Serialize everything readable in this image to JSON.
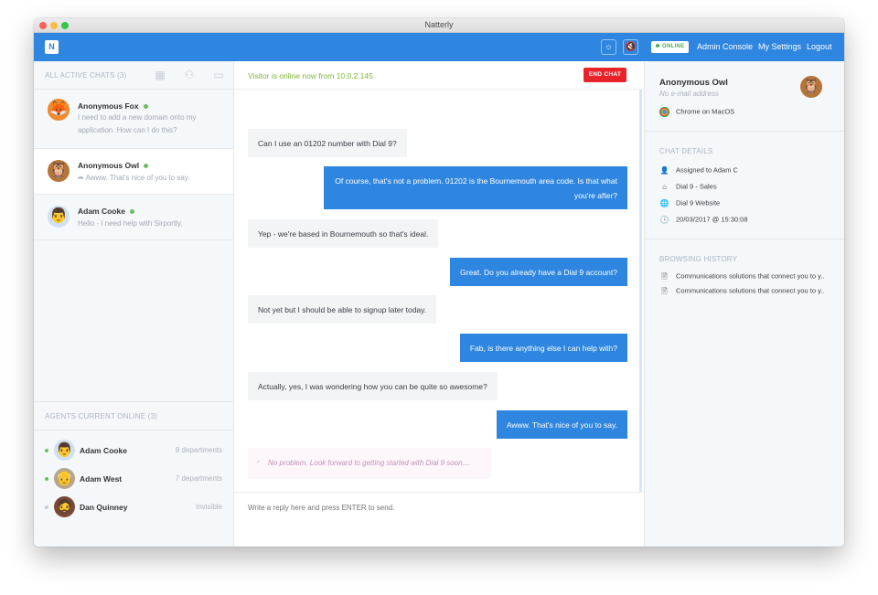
{
  "window": {
    "title": "Natterly"
  },
  "topbar": {
    "logo": "N",
    "status": "ONLINE",
    "links": [
      "Admin Console",
      "My Settings",
      "Logout"
    ]
  },
  "left": {
    "chats_title": "ALL ACTIVE CHATS (3)",
    "chats": [
      {
        "name": "Anonymous Fox",
        "message": "I need to add a new domain onto my application. How can I do this?"
      },
      {
        "name": "Anonymous Owl",
        "message": "Awww. That's nice of you to say."
      },
      {
        "name": "Adam Cooke",
        "message": "Hello - I need help with Sirportly."
      }
    ],
    "agents_title": "AGENTS CURRENT ONLINE (3)",
    "agents": [
      {
        "name": "Adam Cooke",
        "dept": "8 departments"
      },
      {
        "name": "Adam West",
        "dept": "7 departments"
      },
      {
        "name": "Dan Quinney",
        "dept": "Invisible"
      }
    ]
  },
  "center": {
    "visitor_note": "Visitor is online now from 10.0.2.145",
    "end_chat": "END CHAT",
    "messages": [
      "Can I use an 01202 number with Dial 9?",
      "Of course, that's not a problem. 01202 is the Bournemouth area code. Is that what you're after?",
      "Yep - we're based in Bournemouth so that's ideal.",
      "Great. Do you already have a Dial 9 account?",
      "Not yet but I should be able to signup later today.",
      "Fab, is there anything else I can help with?",
      "Actually, yes, I was wondering how you can be quite so awesome?",
      "Awww. That's nice of you to say."
    ],
    "typing": "No problem. Look forward to getting started with Dial 9 soon....",
    "reply_placeholder": "Write a reply here and press ENTER to send."
  },
  "right": {
    "visitor_name": "Anonymous Owl",
    "visitor_email": "No e-mail address",
    "browser": "Chrome on MacOS",
    "details_title": "CHAT DETAILS",
    "details": [
      "Assigned to Adam C",
      "Dial 9 - Sales",
      "Dial 9 Website",
      "20/03/2017 @ 15:30:08"
    ],
    "history_title": "BROWSING HISTORY",
    "history": [
      "Communications solutions that connect you to y..",
      "Communications solutions that connect you to y.."
    ]
  }
}
